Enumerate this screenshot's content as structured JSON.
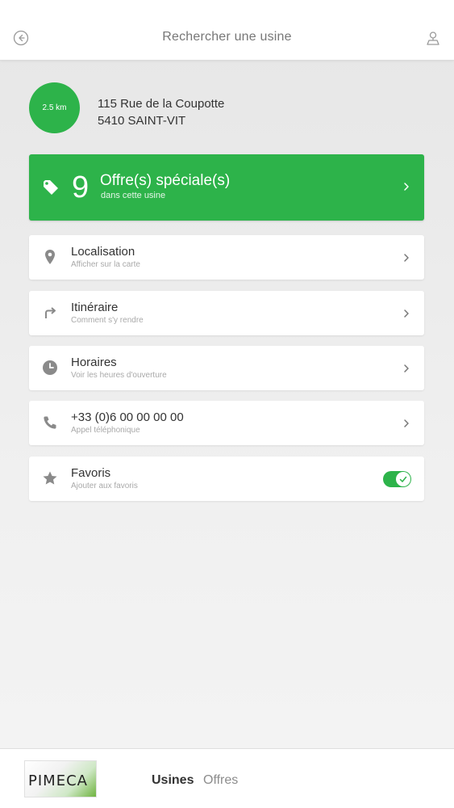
{
  "header": {
    "title": "Rechercher une usine",
    "back_icon": "back-arrow-circle-icon",
    "user_icon": "user-location-icon"
  },
  "plant": {
    "distance": "2.5 km",
    "address_line1": "115 Rue de la Coupotte",
    "address_line2": "5410 SAINT-VIT"
  },
  "offers": {
    "count": "9",
    "label": "Offre(s) spéciale(s)",
    "sublabel": "dans cette usine",
    "icon": "tag-icon",
    "color": "#2db34a"
  },
  "menu": [
    {
      "title": "Localisation",
      "subtitle": "Afficher sur la carte",
      "icon": "map-pin-icon"
    },
    {
      "title": "Itinéraire",
      "subtitle": "Comment s'y rendre",
      "icon": "turn-right-arrow-icon"
    },
    {
      "title": "Horaires",
      "subtitle": "Voir les heures d'ouverture",
      "icon": "clock-icon"
    },
    {
      "title": "+33 (0)6 00 00 00 00",
      "subtitle": "Appel téléphonique",
      "icon": "phone-icon"
    },
    {
      "title": "Favoris",
      "subtitle": "Ajouter aux favoris",
      "icon": "star-icon",
      "toggle_on": true
    }
  ],
  "bottom": {
    "logo_text": "PIMECA",
    "tabs": [
      {
        "label": "Usines",
        "active": true
      },
      {
        "label": "Offres",
        "active": false
      }
    ]
  }
}
